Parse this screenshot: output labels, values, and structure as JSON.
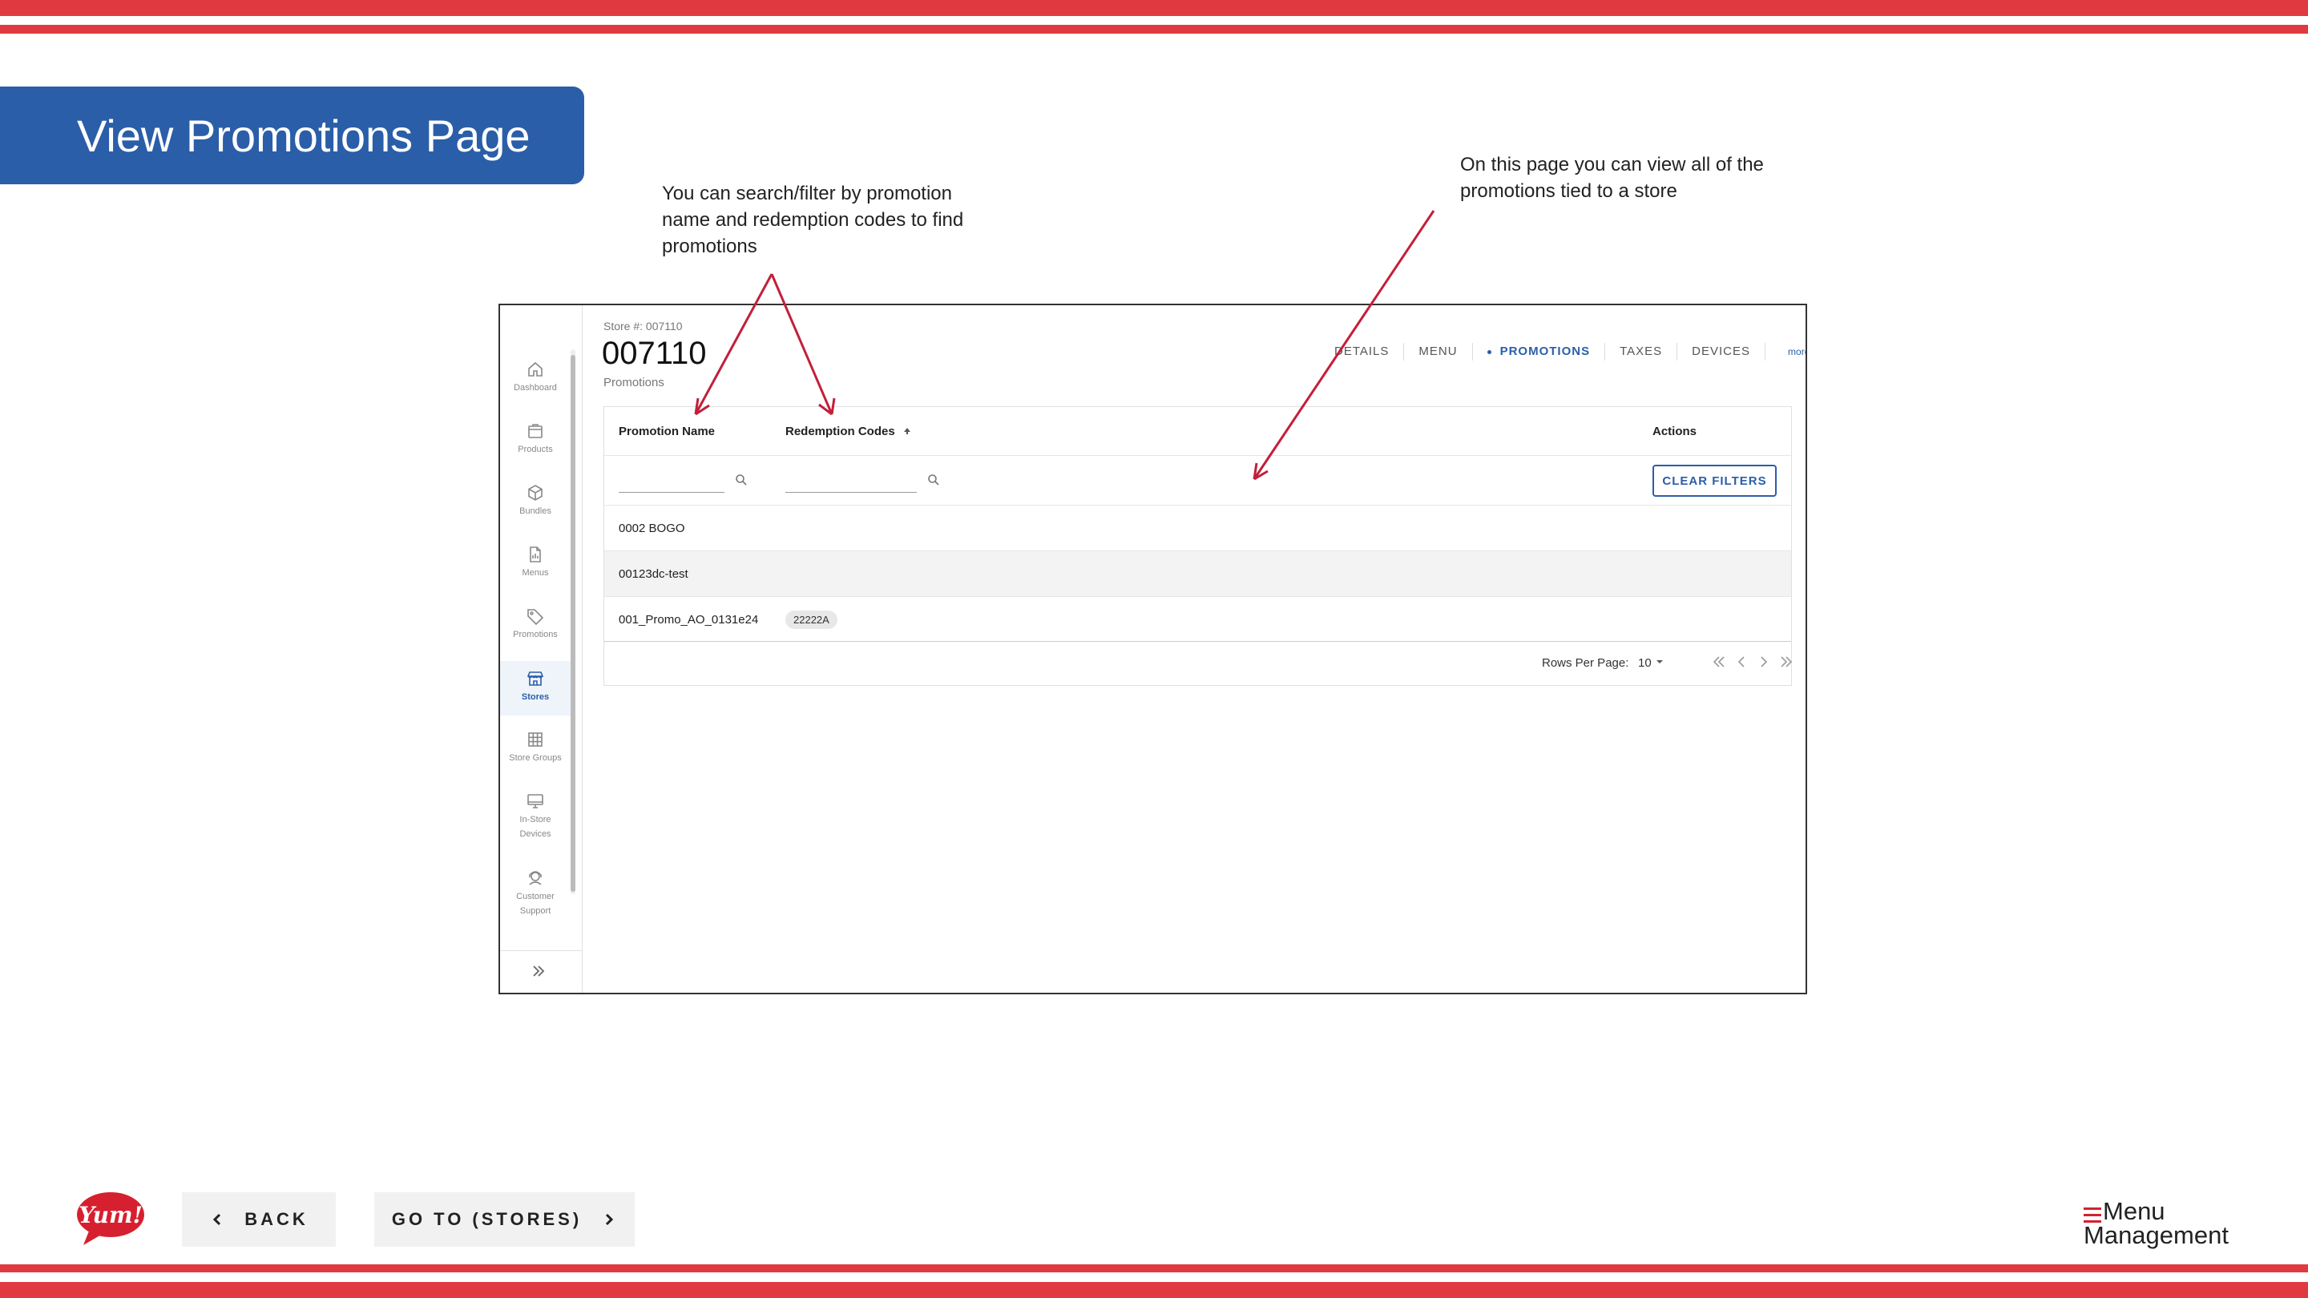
{
  "colors": {
    "stripe": "#e03a40",
    "title_bg": "#2a5ea8",
    "accent": "#2a5ea8",
    "arrow": "#c21f3a"
  },
  "slide": {
    "title": "View Promotions Page",
    "note_left": "You can search/filter by promotion name and redemption codes to find promotions",
    "note_right": "On this page you can view all of the promotions tied to a store"
  },
  "sidebar": {
    "items": [
      {
        "label": "Dashboard",
        "icon": "home-icon"
      },
      {
        "label": "Products",
        "icon": "box-icon"
      },
      {
        "label": "Bundles",
        "icon": "cube-icon"
      },
      {
        "label": "Menus",
        "icon": "document-icon"
      },
      {
        "label": "Promotions",
        "icon": "tag-icon"
      },
      {
        "label": "Stores",
        "icon": "store-icon",
        "active": true
      },
      {
        "label": "Store Groups",
        "icon": "grid-icon"
      },
      {
        "label": "In-Store Devices",
        "icon": "monitor-icon"
      },
      {
        "label": "Customer Support",
        "icon": "support-icon"
      }
    ]
  },
  "header": {
    "store_label": "Store #: 007110",
    "store_title": "007110",
    "breadcrumb": "Promotions"
  },
  "tabs": [
    {
      "label": "DETAILS"
    },
    {
      "label": "MENU"
    },
    {
      "label": "PROMOTIONS",
      "active": true
    },
    {
      "label": "TAXES"
    },
    {
      "label": "DEVICES"
    },
    {
      "label": "more..."
    }
  ],
  "table": {
    "columns": {
      "name": "Promotion Name",
      "codes": "Redemption Codes",
      "actions": "Actions"
    },
    "clear_filters": "CLEAR FILTERS",
    "rows": [
      {
        "name": "0002 BOGO",
        "code": ""
      },
      {
        "name": "00123dc-test",
        "code": ""
      },
      {
        "name": "001_Promo_AO_0131e24",
        "code": "22222A"
      }
    ],
    "rows_per_page_label": "Rows Per Page:",
    "rows_per_page_value": "10"
  },
  "footer": {
    "back_label": "BACK",
    "goto_label": "GO TO (STORES)",
    "yum_logo": "Yum!",
    "brand_line1": "Menu",
    "brand_line2": "Management"
  }
}
